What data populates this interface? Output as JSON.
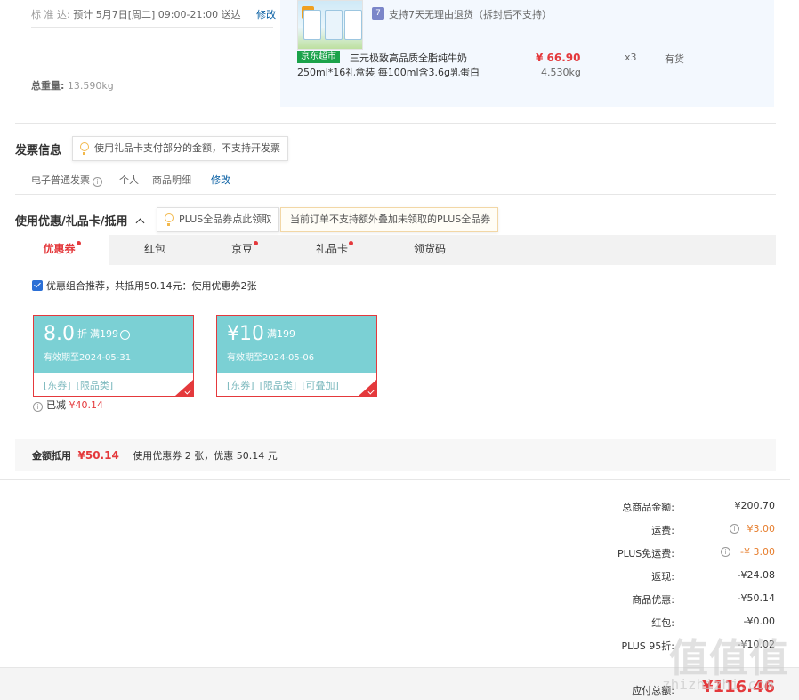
{
  "shipping": {
    "delivery_label": "标 准 达:",
    "delivery_time": "预计 5月7日[周二] 09:00-21:00 送达",
    "modify": "修改",
    "weight_label": "总重量:",
    "weight_value": "13.590kg"
  },
  "product": {
    "return_icon": "7",
    "return_policy": "支持7天无理由退货（拆封后不支持）",
    "store_tag": "京东超市",
    "name": "三元极致高品质全脂纯牛奶",
    "spec": "250ml*16礼盒装 每100ml含3.6g乳蛋白",
    "price": "¥ 66.90",
    "weight": "4.530kg",
    "quantity": "x3",
    "stock": "有货"
  },
  "invoice": {
    "title": "发票信息",
    "tip": "使用礼品卡支付部分的金额，不支持开发票",
    "type": "电子普通发票",
    "holder": "个人",
    "content": "商品明细",
    "modify": "修改"
  },
  "discount": {
    "title": "使用优惠/礼品卡/抵用",
    "tip_plus": "PLUS全品券点此领取",
    "tip_warn": "当前订单不支持额外叠加未领取的PLUS全品券",
    "tabs": [
      {
        "label": "优惠券",
        "dot": true
      },
      {
        "label": "红包",
        "dot": false
      },
      {
        "label": "京豆",
        "dot": true
      },
      {
        "label": "礼品卡",
        "dot": true
      },
      {
        "label": "领货码",
        "dot": false
      }
    ],
    "combo_text": "优惠组合推荐，共抵用50.14元：使用优惠券2张",
    "coupons": [
      {
        "amount": "8.0",
        "unit": "折",
        "threshold": "满199",
        "expiry": "有效期至2024-05-31",
        "tags": [
          "[东券]",
          "[限品类]"
        ]
      },
      {
        "amount": "¥10",
        "unit": "",
        "threshold": "满199",
        "expiry": "有效期至2024-05-06",
        "tags": [
          "[东券]",
          "[限品类]",
          "[可叠加]"
        ]
      }
    ],
    "reduced_label": "已减",
    "reduced_value": "¥40.14",
    "deduct_label": "金额抵用",
    "deduct_value": "¥50.14",
    "deduct_desc": "使用优惠券 2 张，优惠 50.14 元"
  },
  "summary": {
    "rows": [
      {
        "label": "总商品金额:",
        "value": "¥200.70"
      },
      {
        "label": "运费:",
        "value": "¥3.00"
      },
      {
        "label": "PLUS免运费:",
        "value": "-¥ 3.00"
      },
      {
        "label": "返现:",
        "value": "-¥24.08"
      },
      {
        "label": "商品优惠:",
        "value": "-¥50.14"
      },
      {
        "label": "红包:",
        "value": "-¥0.00"
      },
      {
        "label": "PLUS 95折:",
        "value": "-¥10.02"
      }
    ],
    "total_label": "应付总额:",
    "total_value": "¥116.46"
  },
  "watermark": {
    "text": "值值值",
    "url": "zhizhizhi.com"
  }
}
